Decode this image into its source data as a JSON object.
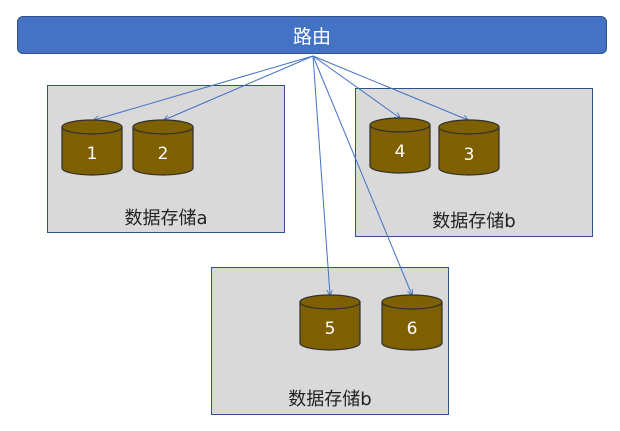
{
  "router": {
    "label": "路由"
  },
  "stores": [
    {
      "label": "数据存储a",
      "disks": [
        "1",
        "2"
      ]
    },
    {
      "label": "数据存储b",
      "disks": [
        "4",
        "3"
      ]
    },
    {
      "label": "数据存储b",
      "disks": [
        "5",
        "6"
      ]
    }
  ],
  "colors": {
    "router_fill": "#4472c4",
    "box_fill": "#d9d9d9",
    "disk_fill": "#7f6000",
    "edge": "#4472c4"
  }
}
